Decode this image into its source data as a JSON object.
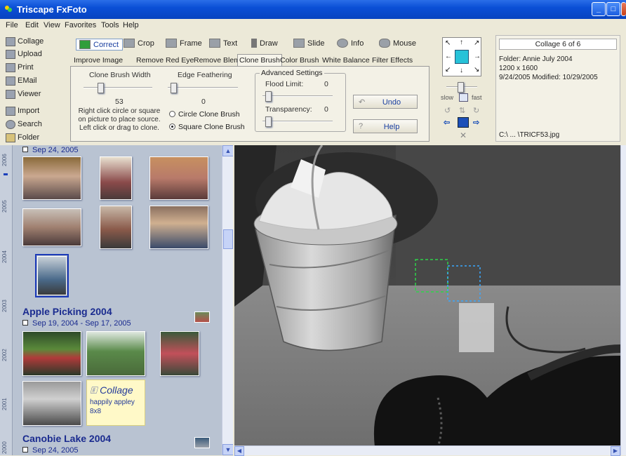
{
  "window": {
    "title": "Triscape FxFoto",
    "min": "_",
    "max": "□",
    "close": "×"
  },
  "menu": [
    "File",
    "Edit",
    "View",
    "Favorites",
    "Tools",
    "Help"
  ],
  "nav": [
    "Collage",
    "Upload",
    "Print",
    "EMail",
    "Viewer",
    "Import",
    "Search",
    "Folder"
  ],
  "tools": [
    "Correct",
    "Crop",
    "Frame",
    "Text",
    "Draw",
    "Slide",
    "Info",
    "Mouse"
  ],
  "subtabs": [
    "Improve Image",
    "Remove Red Eye",
    "Remove Blemish",
    "Clone Brush",
    "Color Brush",
    "White Balance",
    "Filter Effects"
  ],
  "clone": {
    "width_label": "Clone Brush Width",
    "width_value": "53",
    "feather_label": "Edge Feathering",
    "feather_value": "0",
    "hint": "Right click circle or square on picture to place source. Left click or drag to clone.",
    "circle_label": "Circle Clone Brush",
    "square_label": "Square Clone Brush",
    "advanced_label": "Advanced Settings",
    "flood_label": "Flood Limit:",
    "flood_value": "0",
    "transparency_label": "Transparency:",
    "transparency_value": "0",
    "undo_label": "Undo",
    "help_label": "Help"
  },
  "navigator": {
    "slow": "slow",
    "fast": "fast"
  },
  "info": {
    "header": "Collage 6 of 6",
    "folder": "Folder: Annie July 2004",
    "size": "1200 x 1600",
    "dates": "9/24/2005  Modified: 10/29/2005",
    "file": "C:\\ ... \\TRICF53.jpg"
  },
  "timeline_years": [
    "2006",
    "2005",
    "2004",
    "2003",
    "2002",
    "2001",
    "2000"
  ],
  "groups": [
    {
      "title": "",
      "dates": "Sep 24, 2005"
    },
    {
      "title": "Apple Picking 2004",
      "dates": "Sep 19, 2004 - Sep 17, 2005"
    },
    {
      "title": "Canobie Lake 2004",
      "dates": "Sep 24, 2005"
    }
  ],
  "collage_card": {
    "title": "Collage",
    "line1": "happily appley",
    "line2": "8x8"
  }
}
